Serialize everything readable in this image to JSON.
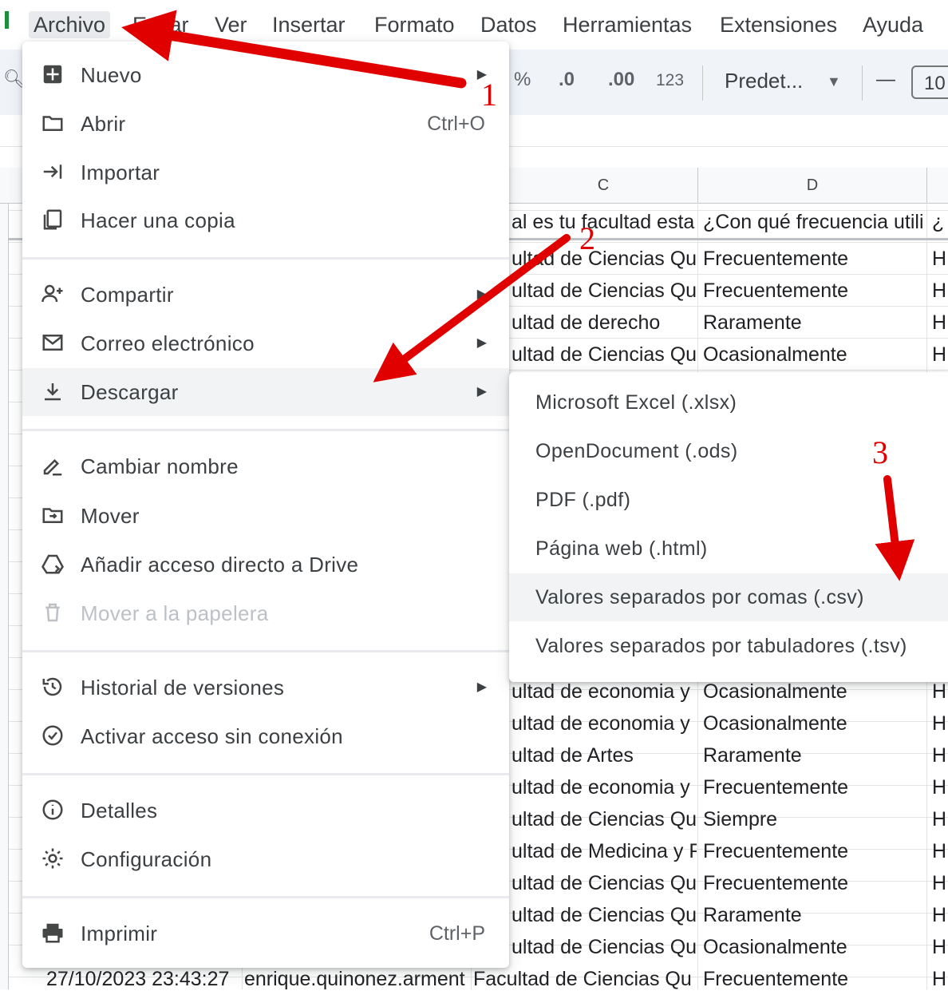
{
  "menubar": {
    "items": [
      "Archivo",
      "Editar",
      "Ver",
      "Insertar",
      "Formato",
      "Datos",
      "Herramientas",
      "Extensiones",
      "Ayuda"
    ]
  },
  "toolbar": {
    "percent": "%",
    "dec_decrease": ".0",
    "dec_increase": ".00",
    "format_number": "123",
    "font_name": "Predet...",
    "minus": "—",
    "font_size": "10"
  },
  "sheet": {
    "columns": [
      "C",
      "D"
    ],
    "header_row": {
      "c": "al es tu facultad esta",
      "d": "¿Con qué frecuencia utili",
      "e": "¿"
    },
    "rows_top": [
      {
        "c": "ultad de Ciencias  Qu",
        "d": "Frecuentemente",
        "e": "H"
      },
      {
        "c": "ultad de Ciencias  Qu",
        "d": "Frecuentemente",
        "e": "H"
      },
      {
        "c": "ultad de derecho",
        "d": "Raramente",
        "e": "H"
      },
      {
        "c": "ultad de Ciencias  Qu",
        "d": "Ocasionalmente",
        "e": "H"
      }
    ],
    "rows_bottom": [
      {
        "c": "ultad de economia y i",
        "d": "Ocasionalmente",
        "e": "H"
      },
      {
        "c": "ultad de economia y i",
        "d": "Ocasionalmente",
        "e": "H"
      },
      {
        "c": "ultad de Artes",
        "d": "Raramente",
        "e": "H"
      },
      {
        "c": "ultad de economia y i",
        "d": "Frecuentemente",
        "e": "H"
      },
      {
        "c": "ultad de Ciencias  Qu",
        "d": "Siempre",
        "e": "H"
      },
      {
        "c": "ultad de Medicina y F",
        "d": "Frecuentemente",
        "e": "H"
      },
      {
        "c": "ultad de Ciencias  Qu",
        "d": "Frecuentemente",
        "e": "H"
      },
      {
        "c": "ultad de Ciencias  Qu",
        "d": "Raramente",
        "e": "H"
      },
      {
        "c": "ultad de Ciencias  Qu",
        "d": "Ocasionalmente",
        "e": "H"
      }
    ],
    "last_row": {
      "a": "27/10/2023 23:43:27",
      "b": "enrique.quinonez.arment",
      "c": "Facultad de Ciencias  Qu",
      "d": "Frecuentemente",
      "e": "H"
    }
  },
  "menu": {
    "nuevo": "Nuevo",
    "abrir": "Abrir",
    "abrir_shortcut": "Ctrl+O",
    "importar": "Importar",
    "copia": "Hacer una copia",
    "compartir": "Compartir",
    "correo": "Correo electrónico",
    "descargar": "Descargar",
    "cambiar_nombre": "Cambiar nombre",
    "mover": "Mover",
    "acceso_directo": "Añadir acceso directo a Drive",
    "papelera": "Mover a la papelera",
    "historial": "Historial de versiones",
    "sin_conexion": "Activar acceso sin conexión",
    "detalles": "Detalles",
    "configuracion": "Configuración",
    "imprimir": "Imprimir",
    "imprimir_shortcut": "Ctrl+P"
  },
  "submenu": {
    "items": [
      "Microsoft Excel (.xlsx)",
      "OpenDocument (.ods)",
      "PDF (.pdf)",
      "Página web (.html)",
      "Valores separados por comas (.csv)",
      "Valores separados por tabuladores (.tsv)"
    ]
  },
  "annotations": {
    "step1": "1",
    "step2": "2",
    "step3": "3",
    "arrow_color": "#e00000"
  }
}
